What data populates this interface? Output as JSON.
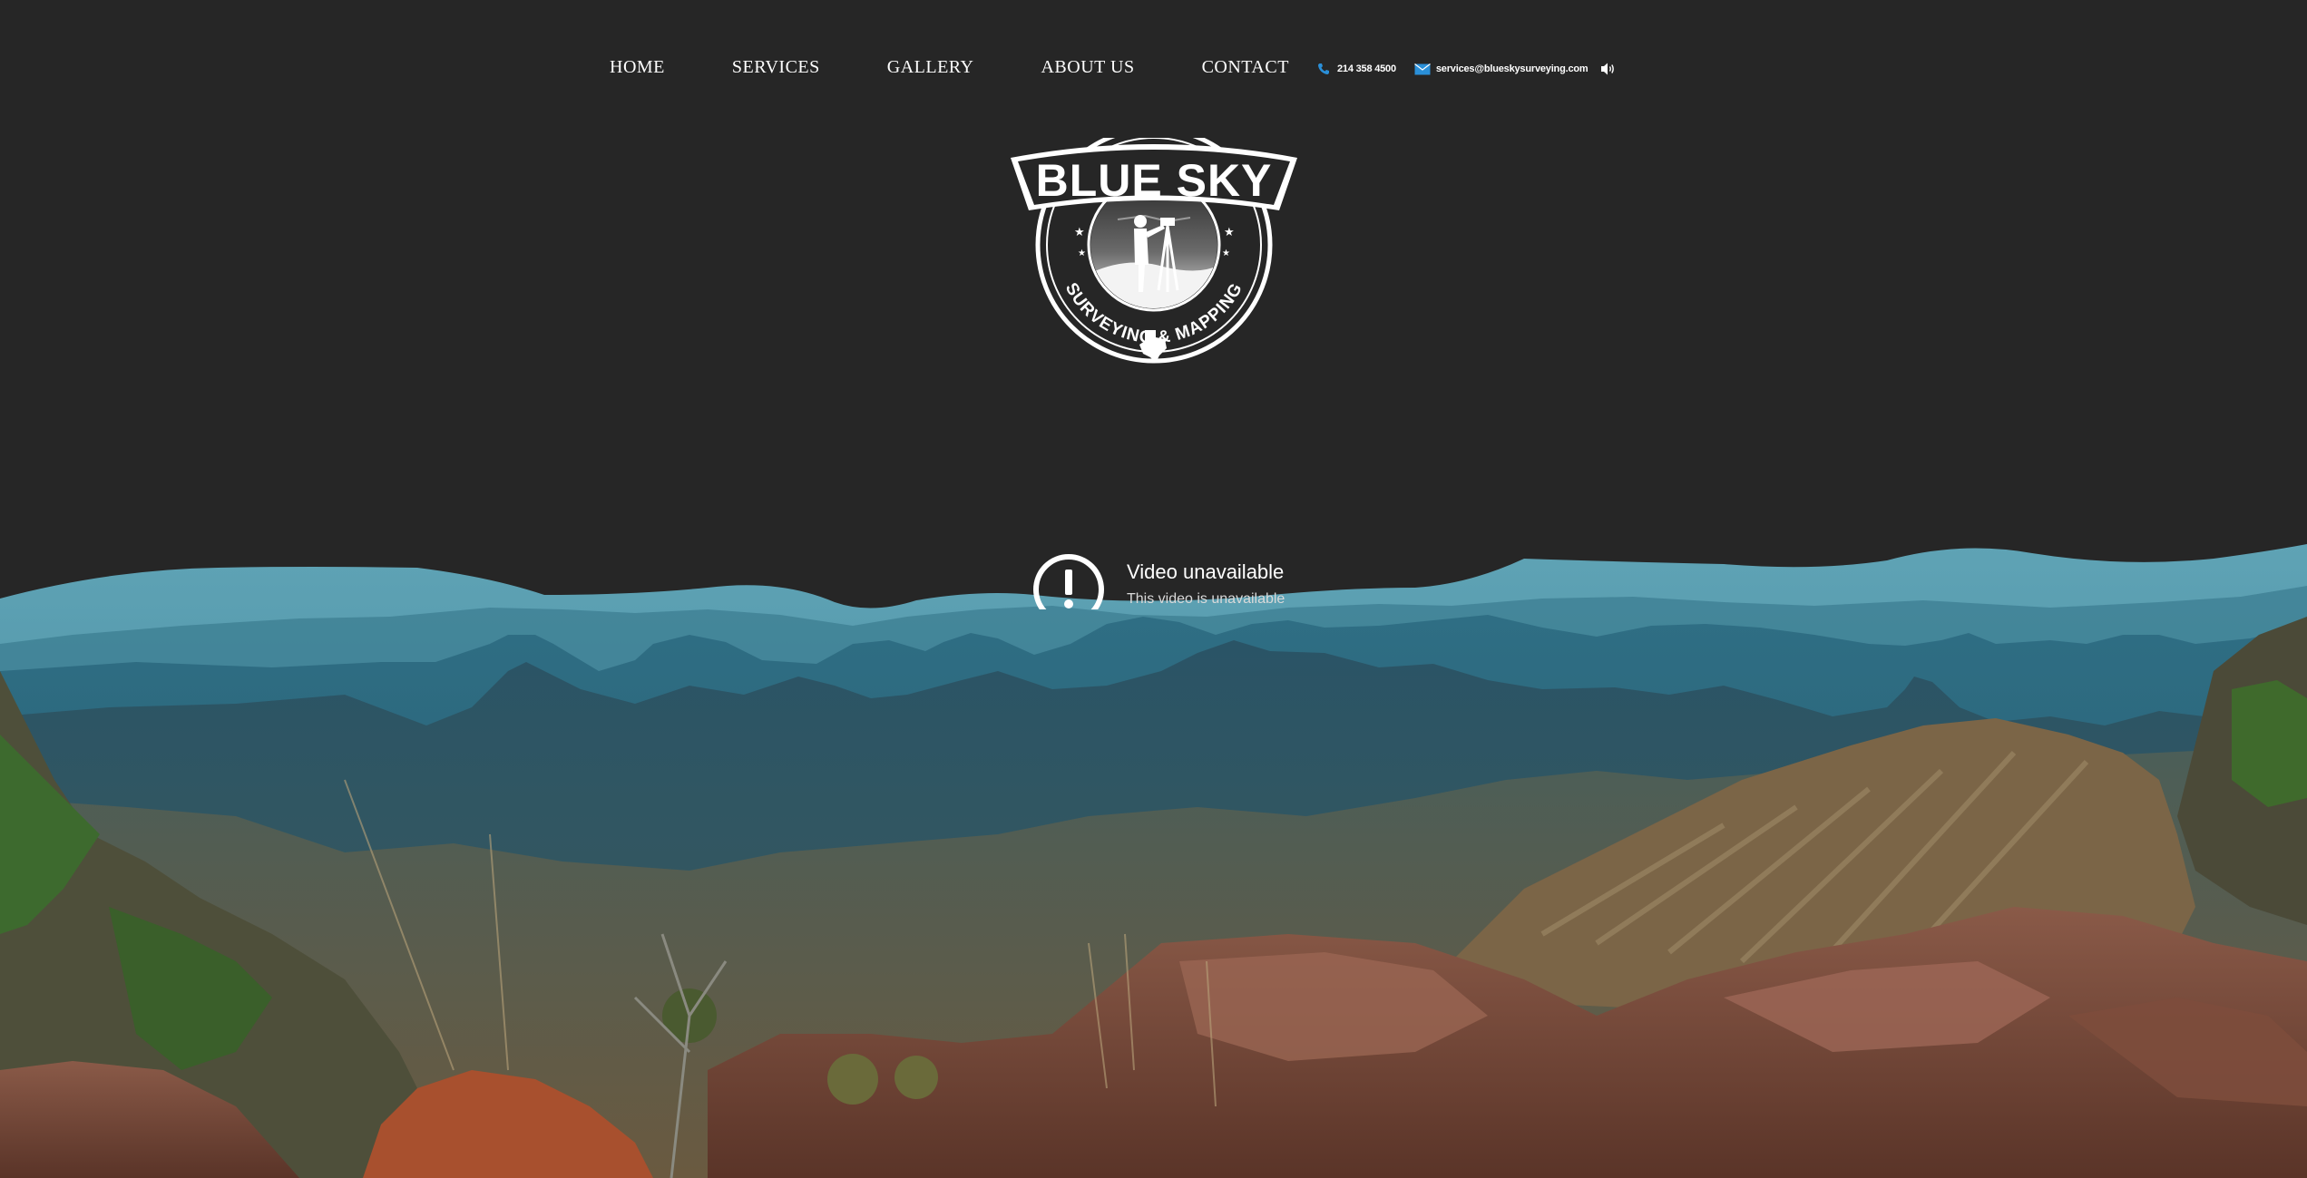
{
  "nav": {
    "home": "HOME",
    "services": "SERVICES",
    "gallery": "GALLERY",
    "about": "ABOUT US",
    "contact": "CONTACT"
  },
  "contact_bar": {
    "phone": "214 358 4500",
    "phone_icon": "phone-icon",
    "email": "services@blueskysurveying.com",
    "email_icon": "envelope-icon",
    "sound_icon": "speaker-icon"
  },
  "logo": {
    "title": "BLUE SKY",
    "subtitle": "SURVEYING & MAPPING"
  },
  "video": {
    "title": "Video unavailable",
    "subtitle": "This video is unavailable"
  },
  "colors": {
    "background": "#262626",
    "accent_icon": "#2a8fd8",
    "sky": "#4f93a6"
  }
}
